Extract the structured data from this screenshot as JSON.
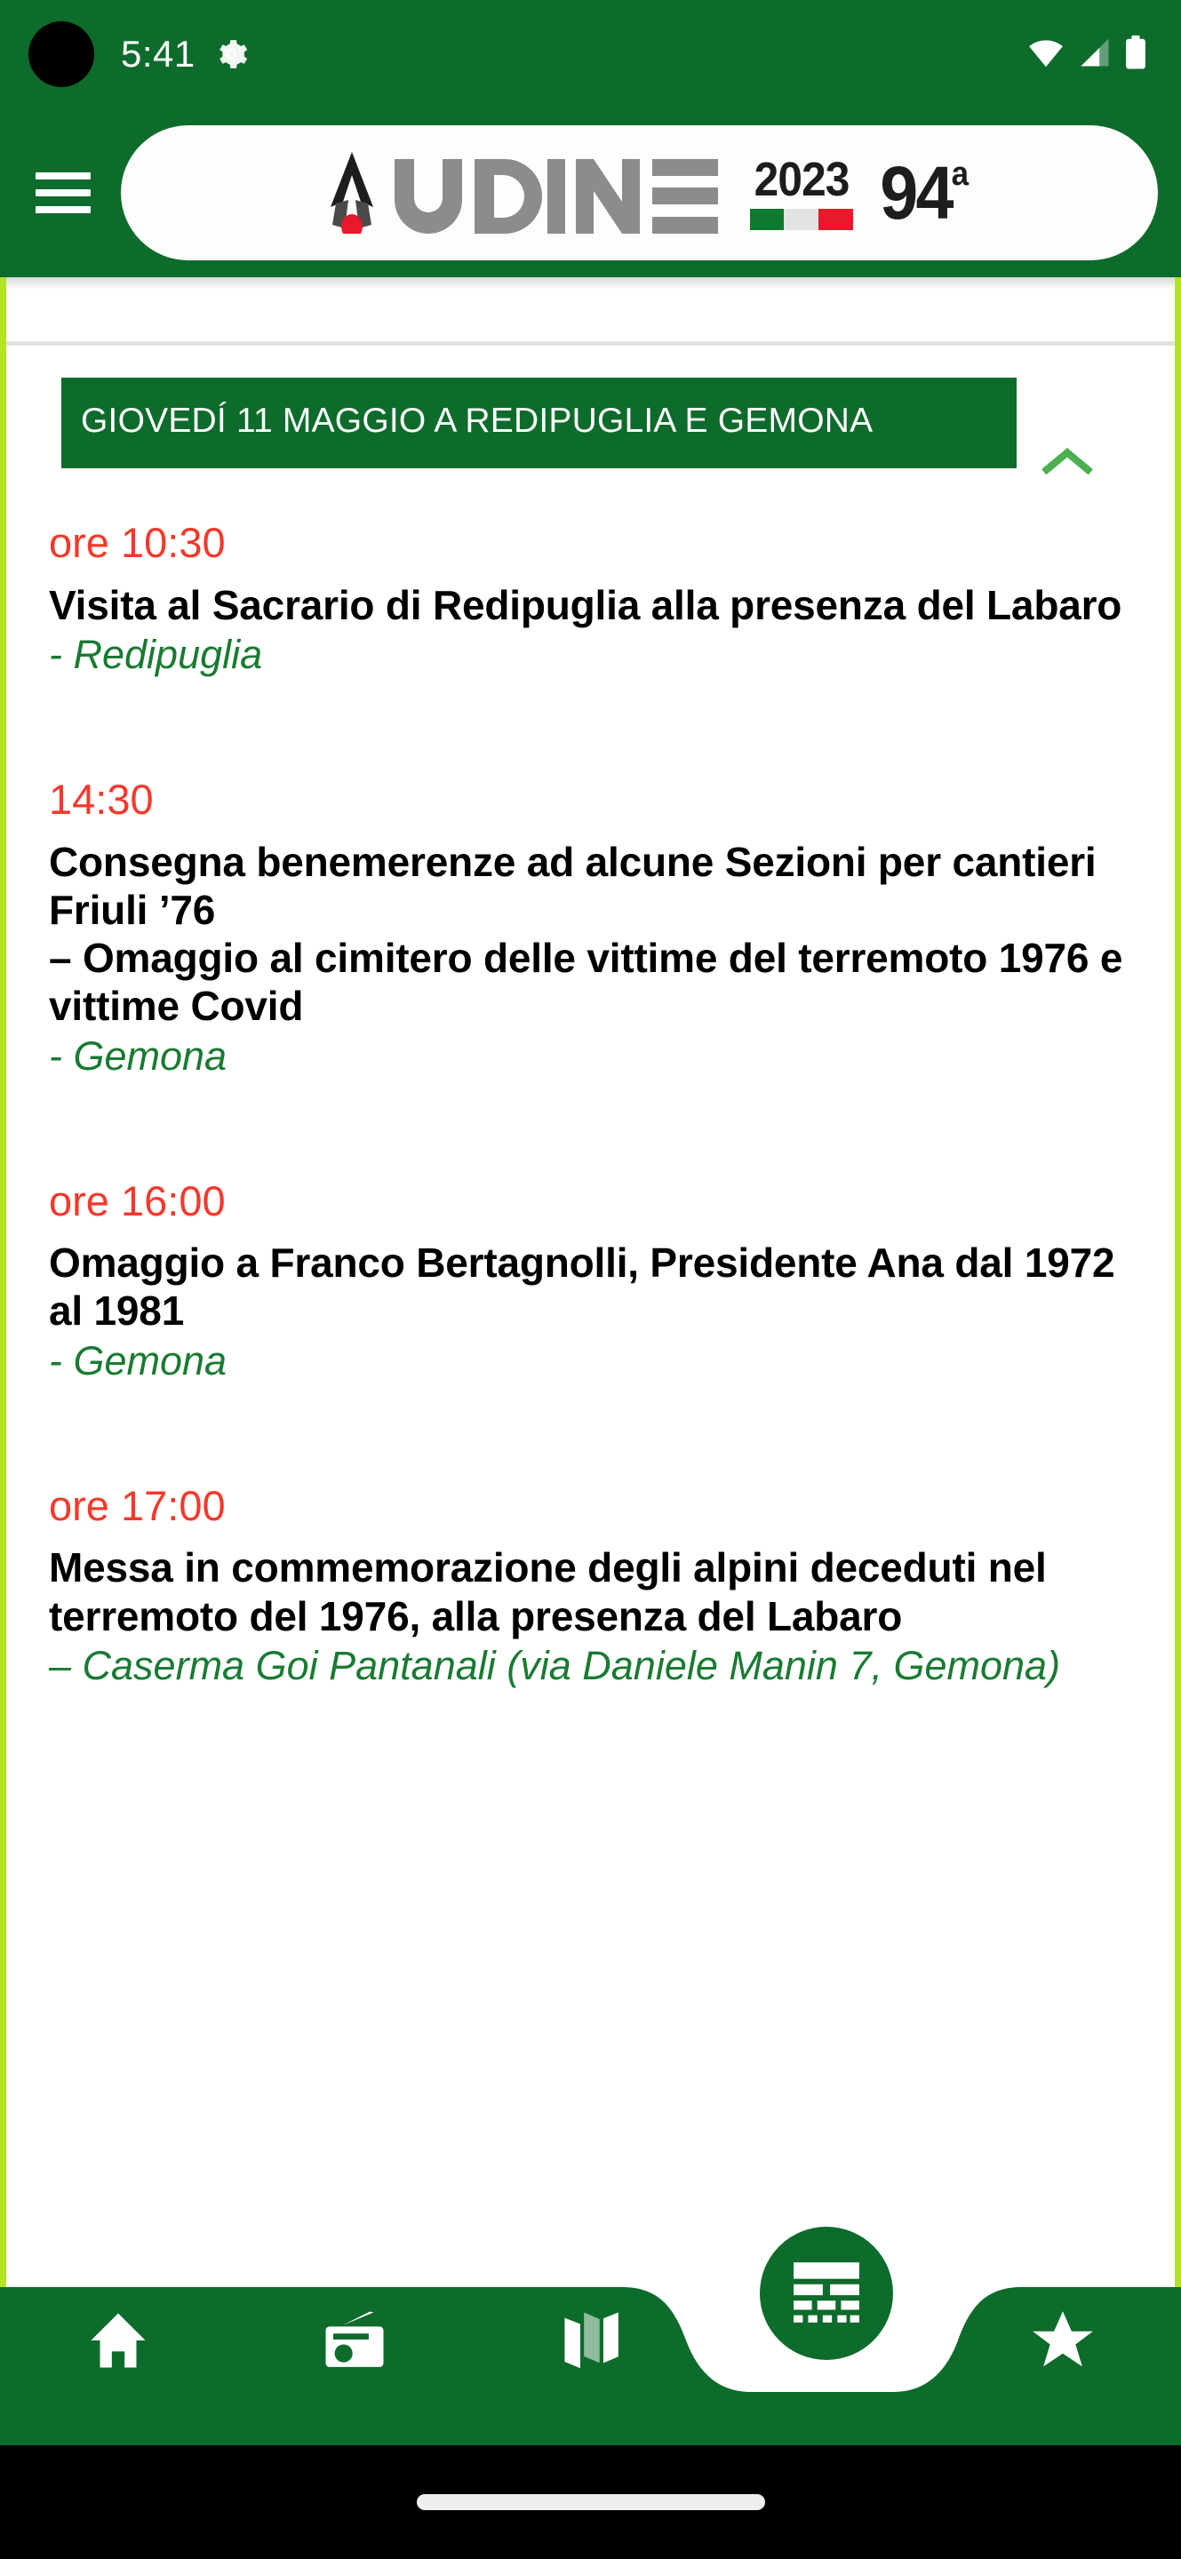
{
  "status_bar": {
    "time": "5:41",
    "icons": [
      "gear-icon",
      "wifi-icon",
      "cellular-signal-icon",
      "battery-icon"
    ]
  },
  "app_bar": {
    "menu_label": "Menu",
    "logo": {
      "wordmark": "UDINE",
      "year": "2023",
      "edition_number": "94",
      "edition_suffix": "a",
      "flag_colors": [
        "#0d7a30",
        "#e3e3e3",
        "#e8192c"
      ],
      "accent_red": "#e8192c"
    }
  },
  "day_section": {
    "title": "GIOVEDÍ 11 MAGGIO A REDIPUGLIA E GEMONA",
    "collapse_icon": "chevron-up-icon",
    "expanded": true
  },
  "events": [
    {
      "time": "ore 10:30",
      "title": "Visita al Sacrario di Redipuglia alla presenza del Labaro",
      "place": "- Redipuglia"
    },
    {
      "time": "14:30",
      "title": "Consegna benemerenze ad alcune Sezioni per cantieri Friuli ’76\n– Omaggio al cimitero delle vittime del terremoto 1976 e vittime Covid",
      "place": "- Gemona"
    },
    {
      "time": "ore 16:00",
      "title": "Omaggio a Franco Bertagnolli, Presidente Ana dal 1972 al 1981",
      "place": "- Gemona"
    },
    {
      "time": "ore 17:00",
      "title": "Messa in commemorazione degli alpini deceduti nel terremoto del 1976, alla presenza del Labaro",
      "place": "–  Caserma Goi Pantanali (via Daniele Manin 7, Gemona)"
    }
  ],
  "bottom_nav": {
    "items": [
      {
        "icon": "home-icon",
        "label": "Home"
      },
      {
        "icon": "radio-icon",
        "label": "Radio"
      },
      {
        "icon": "map-icon",
        "label": "Mappa"
      },
      {
        "icon": "program-icon",
        "label": "Programma"
      },
      {
        "icon": "star-icon",
        "label": "Preferiti"
      }
    ]
  },
  "theme": {
    "primary_green": "#0d6b2b",
    "accent_lime": "#b4e225",
    "time_red": "#f4392c",
    "place_green": "#1a7a33",
    "chevron_green": "#4caf50"
  }
}
